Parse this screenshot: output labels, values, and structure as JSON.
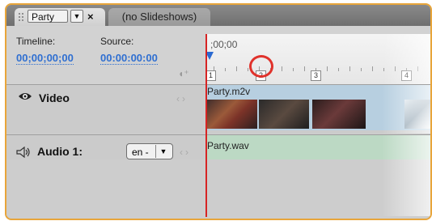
{
  "tabs": {
    "active_name": "Party",
    "close_label": "×",
    "inactive_label": "(no Slideshows)"
  },
  "header": {
    "timeline_label": "Timeline:",
    "source_label": "Source:",
    "timeline_value": "00;00;00;00",
    "source_value": "00:00:00:00"
  },
  "ruler": {
    "time_label": ";00;00",
    "markers": [
      "1",
      "2",
      "3",
      "4"
    ]
  },
  "video_track": {
    "name": "Video",
    "clip_name": "Party.m2v"
  },
  "audio_track": {
    "name": "Audio 1:",
    "language": "en -",
    "clip_name": "Party.wav"
  },
  "colors": {
    "panel_border": "#e8a53a",
    "timecode": "#2f6fd1",
    "playhead": "#d62424",
    "highlight": "#e0322b",
    "video_clip": "#b7cfe0",
    "audio_clip": "#bcd9c4"
  },
  "icons": {
    "drag_grip": "grip-icon",
    "dropdown": "chevron-down-icon",
    "close": "close-icon",
    "eye": "eye-icon",
    "speaker": "speaker-icon",
    "snap": "snap-icon"
  }
}
